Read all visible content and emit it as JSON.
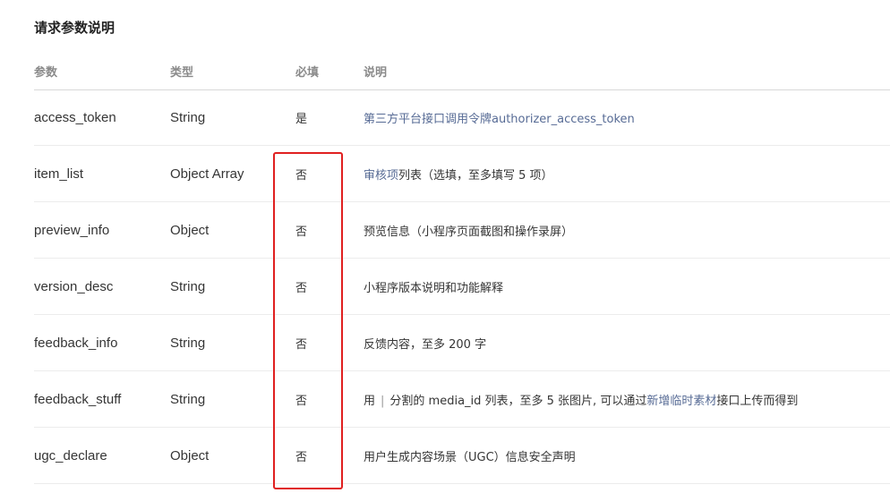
{
  "section": {
    "title": "请求参数说明"
  },
  "table": {
    "headers": [
      "参数",
      "类型",
      "必填",
      "说明"
    ],
    "rows": [
      {
        "param": "access_token",
        "type": "String",
        "required": "是",
        "description": [
          {
            "text": "第三方平台接口调用令牌authorizer_access_token",
            "link": true
          }
        ]
      },
      {
        "param": "item_list",
        "type": "Object Array",
        "required": "否",
        "description": [
          {
            "text": "审核项",
            "link": true
          },
          {
            "text": "列表（选填，至多填写 5 项）",
            "link": false
          }
        ]
      },
      {
        "param": "preview_info",
        "type": "Object",
        "required": "否",
        "description": [
          {
            "text": "预览信息（小程序页面截图和操作录屏）",
            "link": false
          }
        ]
      },
      {
        "param": "version_desc",
        "type": "String",
        "required": "否",
        "description": [
          {
            "text": "小程序版本说明和功能解释",
            "link": false
          }
        ]
      },
      {
        "param": "feedback_info",
        "type": "String",
        "required": "否",
        "description": [
          {
            "text": "反馈内容，至多 200 字",
            "link": false
          }
        ]
      },
      {
        "param": "feedback_stuff",
        "type": "String",
        "required": "否",
        "description": [
          {
            "text": "用",
            "link": false
          },
          {
            "text": "|",
            "code": true
          },
          {
            "text": "分割的 media_id 列表，至多 5 张图片, 可以通过",
            "link": false
          },
          {
            "text": "新增临时素材",
            "link": true
          },
          {
            "text": "接口上传而得到",
            "link": false
          }
        ]
      },
      {
        "param": "ugc_declare",
        "type": "Object",
        "required": "否",
        "description": [
          {
            "text": "用户生成内容场景（UGC）信息安全声明",
            "link": false
          }
        ]
      }
    ]
  },
  "annotation": {
    "highlight_color": "#e02020"
  },
  "colors": {
    "link": "#576b95",
    "text": "#353535",
    "header_text": "#8a8a8a"
  }
}
